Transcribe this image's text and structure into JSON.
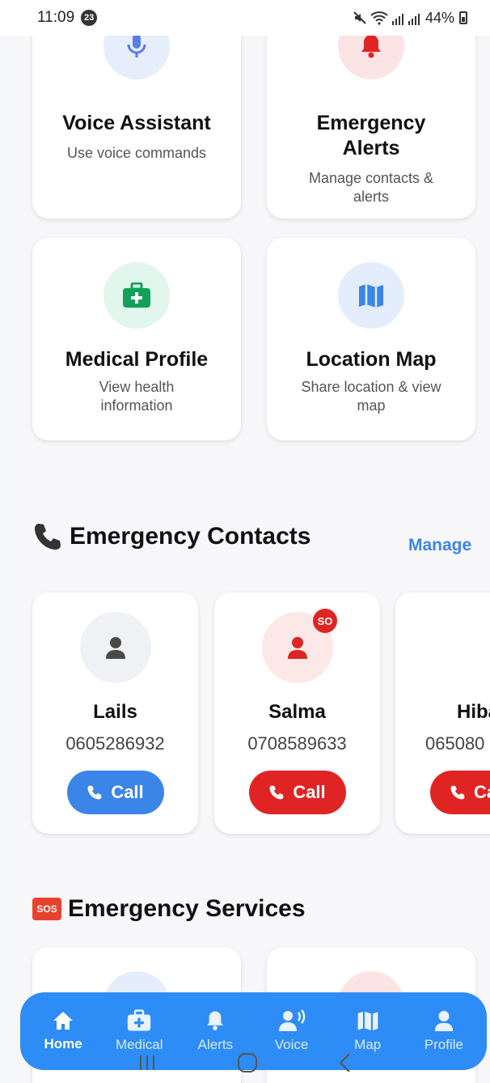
{
  "status_bar": {
    "time": "11:09",
    "notification_count": "23",
    "battery": "44%"
  },
  "features": [
    {
      "title": "Voice Assistant",
      "subtitle": "Use voice commands",
      "icon": "microphone-icon",
      "color": "#5b7ee5",
      "bg": "#e6eefc"
    },
    {
      "title": "Emergency Alerts",
      "subtitle": "Manage contacts & alerts",
      "icon": "bell-icon",
      "color": "#e02424",
      "bg": "#fde4e4"
    },
    {
      "title": "Medical Profile",
      "subtitle": "View health information",
      "icon": "medical-kit-icon",
      "color": "#12a05a",
      "bg": "#e1f6ec"
    },
    {
      "title": "Location Map",
      "subtitle": "Share location & view map",
      "icon": "map-icon",
      "color": "#3c85e8",
      "bg": "#e3edfc"
    }
  ],
  "contacts_section": {
    "title": "Emergency Contacts",
    "manage_label": "Manage"
  },
  "contacts": [
    {
      "name": "Lails",
      "phone": "0605286932",
      "call_label": "Call",
      "call_color": "#3c85e8",
      "avatar_color": "#4a4a4a",
      "avatar_bg": "#f0f1f4"
    },
    {
      "name": "Salma",
      "phone": "0708589633",
      "call_label": "Call",
      "call_color": "#e02424",
      "avatar_color": "#e02424",
      "avatar_bg": "#fde8e8",
      "badge": "SO"
    },
    {
      "name": "Hiba",
      "phone": "065080",
      "call_label": "Ca",
      "call_color": "#e02424",
      "avatar_color": "#e02424",
      "avatar_bg": "#fde8e8"
    }
  ],
  "services_section": {
    "sos_label": "SOS",
    "title": "Emergency Services"
  },
  "bottom_nav": [
    {
      "label": "Home",
      "icon": "home-icon",
      "active": true
    },
    {
      "label": "Medical",
      "icon": "medical-kit-icon",
      "active": false
    },
    {
      "label": "Alerts",
      "icon": "bell-icon",
      "active": false
    },
    {
      "label": "Voice",
      "icon": "voice-user-icon",
      "active": false
    },
    {
      "label": "Map",
      "icon": "map-icon",
      "active": false
    },
    {
      "label": "Profile",
      "icon": "user-icon",
      "active": false
    }
  ]
}
